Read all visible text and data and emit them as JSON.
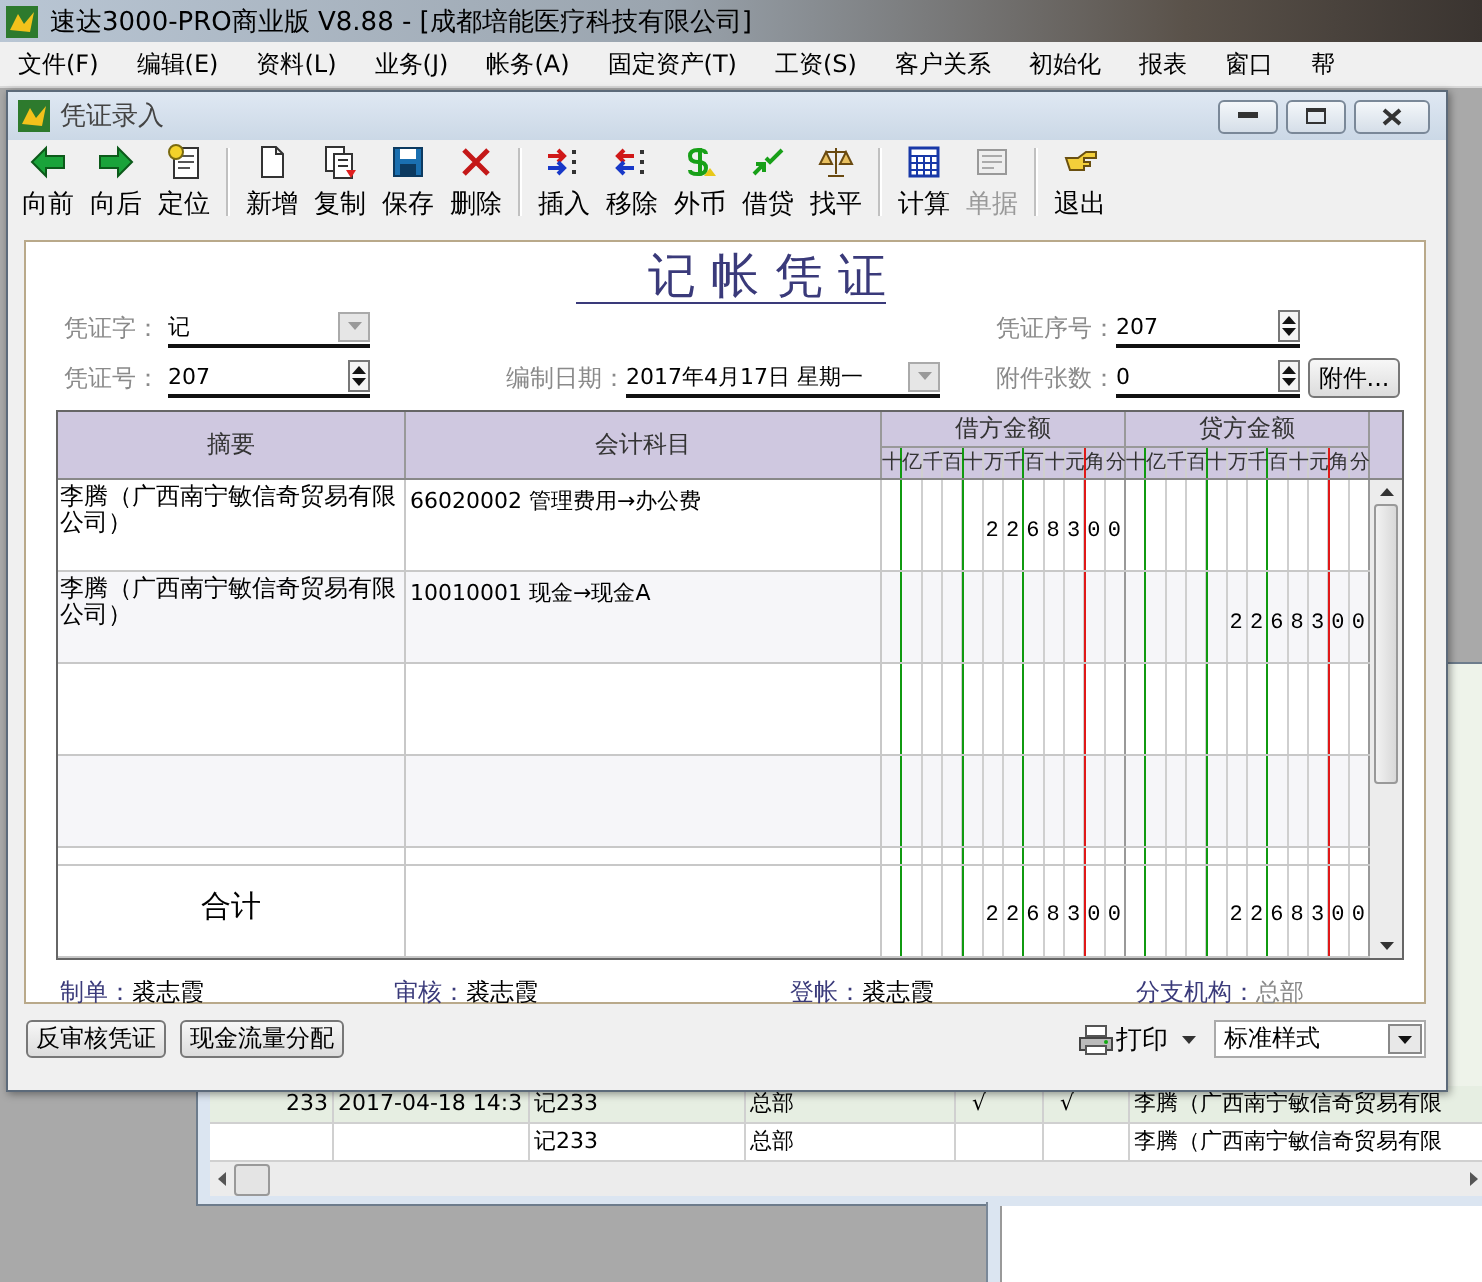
{
  "app": {
    "title": "速达3000-PRO商业版 V8.88 - [成都培能医疗科技有限公司]"
  },
  "menu": [
    "文件(F)",
    "编辑(E)",
    "资料(L)",
    "业务(J)",
    "帐务(A)",
    "固定资产(T)",
    "工资(S)",
    "客户关系",
    "初始化",
    "报表",
    "窗口",
    "帮"
  ],
  "list_window": {
    "rows": [
      {
        "selected": true,
        "column_1": "233",
        "column_2": "2017-04-18 14:3",
        "column_3": "记233",
        "column_4": "总部",
        "column_5": "√",
        "column_6": "√",
        "column_7": "李腾（广西南宁敏信奇贸易有限"
      },
      {
        "selected": false,
        "column_3": "记233",
        "column_4": "总部",
        "column_7": "李腾（广西南宁敏信奇贸易有限"
      }
    ]
  },
  "dialog": {
    "title": "凭证录入",
    "toolbar": [
      [
        {
          "label": "向前",
          "disabled": false
        },
        {
          "label": "向后",
          "disabled": false
        },
        {
          "label": "定位",
          "disabled": false
        }
      ],
      [
        {
          "label": "新增",
          "disabled": false
        },
        {
          "label": "复制",
          "disabled": false
        },
        {
          "label": "保存",
          "disabled": false
        },
        {
          "label": "删除",
          "disabled": false
        }
      ],
      [
        {
          "label": "插入",
          "disabled": false
        },
        {
          "label": "移除",
          "disabled": false
        },
        {
          "label": "外币",
          "disabled": false
        },
        {
          "label": "借贷",
          "disabled": false
        },
        {
          "label": "找平",
          "disabled": false
        }
      ],
      [
        {
          "label": "计算",
          "disabled": false
        },
        {
          "label": "单据",
          "disabled": true
        }
      ],
      [
        {
          "label": "退出",
          "disabled": false
        }
      ]
    ],
    "voucher": {
      "title": "记 帐 凭 证",
      "voucher_type": {
        "label": "凭证字：",
        "value": "记"
      },
      "serial": {
        "label": "凭证序号：",
        "value": "207"
      },
      "number": {
        "label": "凭证号：",
        "value": "207"
      },
      "date": {
        "label": "编制日期：",
        "value": "2017年4月17日  星期一"
      },
      "attachments": {
        "label": "附件张数：",
        "value": "0"
      },
      "attach_button": "附件...",
      "table": {
        "summary_header": "摘要",
        "account_header": "会计科目",
        "debit_header": {
          "label": "借方金额",
          "units": "十亿千百十万千百十元角分"
        },
        "credit_header": {
          "label": "贷方金额",
          "units": "十亿千百十万千百十元角分"
        },
        "rows": [
          {
            "summary": "李腾（广西南宁敏信奇贸易有限公司）",
            "account": "66020002 管理费用→办公费",
            "debit": "2268300"
          },
          {
            "summary": "李腾（广西南宁敏信奇贸易有限公司）",
            "account": "10010001 现金→现金A",
            "credit": "2268300"
          },
          {},
          {}
        ],
        "total": {
          "label": "合计",
          "debit": "2268300",
          "credit": "2268300"
        }
      },
      "footer": [
        {
          "label": "制单：",
          "value": "裘志霞",
          "disabled": false
        },
        {
          "label": "审核：",
          "value": "裘志霞",
          "disabled": false
        },
        {
          "label": "登帐：",
          "value": "裘志霞",
          "disabled": false
        },
        {
          "label": "分支机构：",
          "value": "总部",
          "disabled": true
        }
      ]
    },
    "buttons": [
      "反审核凭证",
      "现金流量分配"
    ],
    "print": {
      "label": "打印",
      "style": "标准样式"
    }
  }
}
